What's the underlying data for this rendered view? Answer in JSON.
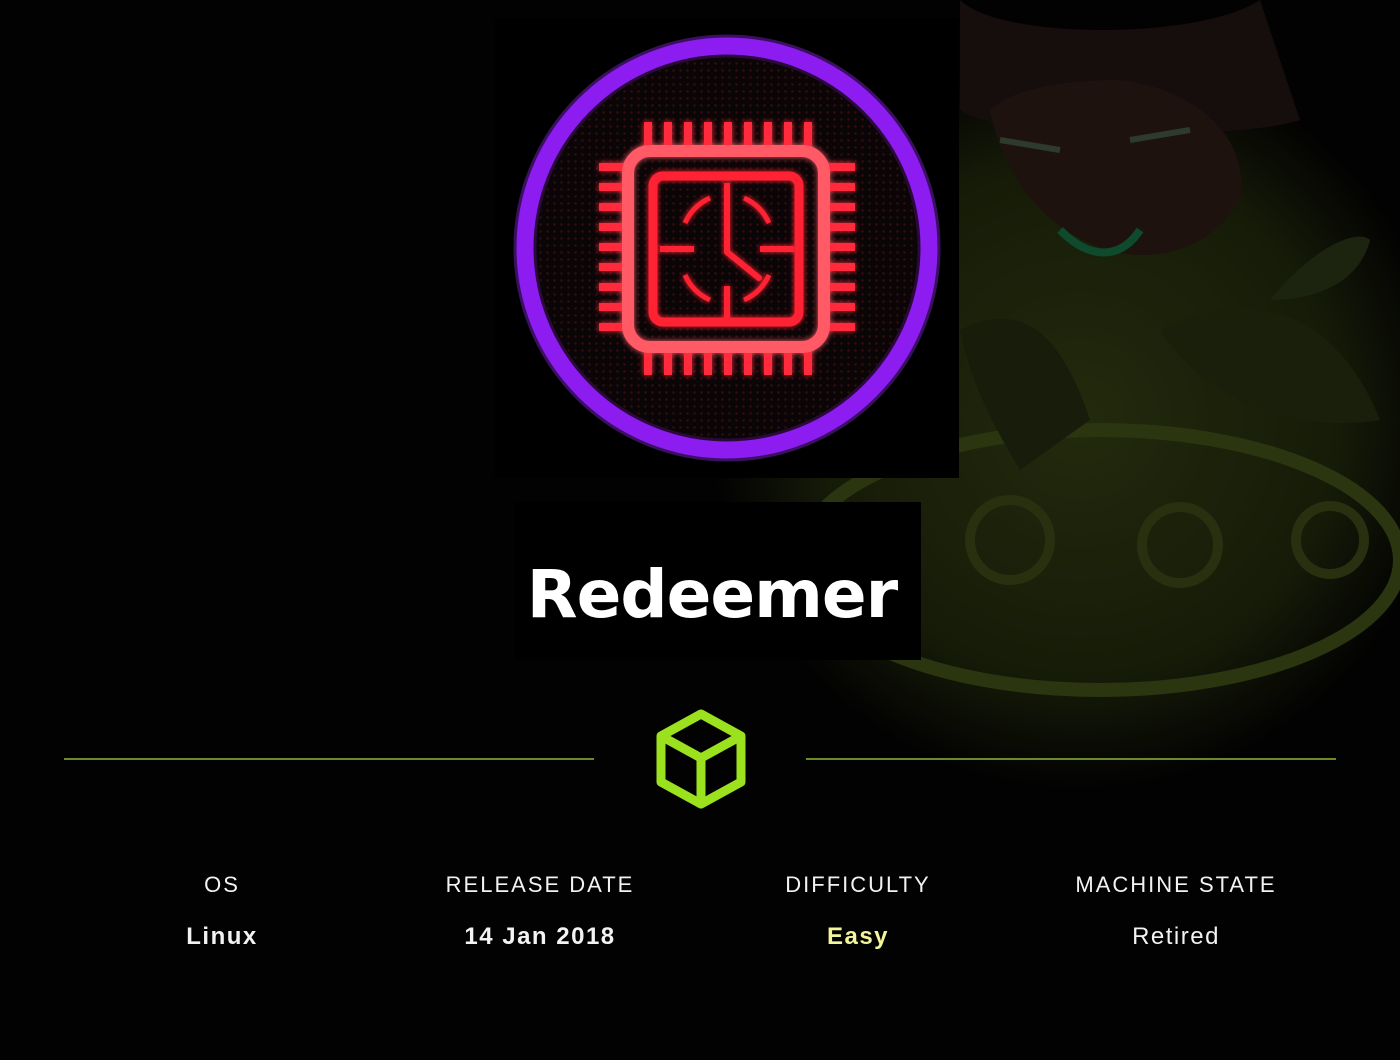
{
  "machine": {
    "name": "Redeemer"
  },
  "colors": {
    "ring": "#8c1cf0",
    "chip": "#ff2233",
    "accent": "#9ce11e",
    "divider": "#6d8a2a",
    "difficulty_easy": "#f4f59a"
  },
  "icons": {
    "avatar": "cpu-clock-icon",
    "platform": "cube-icon"
  },
  "stats": [
    {
      "label": "OS",
      "value": "Linux"
    },
    {
      "label": "RELEASE DATE",
      "value": "14 Jan 2018"
    },
    {
      "label": "DIFFICULTY",
      "value": "Easy"
    },
    {
      "label": "MACHINE STATE",
      "value": "Retired"
    }
  ]
}
